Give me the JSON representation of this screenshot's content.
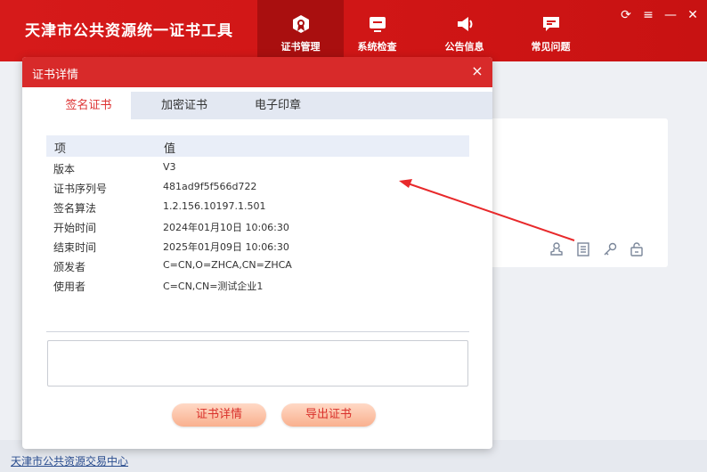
{
  "app": {
    "title": "天津市公共资源统一证书工具"
  },
  "nav": [
    {
      "label": "证书管理",
      "icon": "certificate-icon",
      "active": true
    },
    {
      "label": "系统检查",
      "icon": "monitor-icon",
      "active": false
    },
    {
      "label": "公告信息",
      "icon": "megaphone-icon",
      "active": false
    },
    {
      "label": "常见问题",
      "icon": "chat-icon",
      "active": false
    }
  ],
  "window_controls": {
    "refresh": "⟳",
    "menu": "≡",
    "minimize": "—",
    "close": "✕"
  },
  "dialog": {
    "title": "证书详情",
    "close": "×",
    "tabs": [
      {
        "label": "签名证书",
        "active": true
      },
      {
        "label": "加密证书",
        "active": false
      },
      {
        "label": "电子印章",
        "active": false
      }
    ],
    "table": {
      "headers": [
        "项",
        "值"
      ],
      "rows": [
        {
          "key": "版本",
          "value": "V3"
        },
        {
          "key": "证书序列号",
          "value": "481ad9f5f566d722"
        },
        {
          "key": "签名算法",
          "value": "1.2.156.10197.1.501"
        },
        {
          "key": "开始时间",
          "value": "2024年01月10日 10:06:30"
        },
        {
          "key": "结束时间",
          "value": "2025年01月09日 10:06:30"
        },
        {
          "key": "颁发者",
          "value": "C=CN,O=ZHCA,CN=ZHCA"
        },
        {
          "key": "使用者",
          "value": "C=CN,CN=测试企业1"
        }
      ]
    },
    "buttons": {
      "details": "证书详情",
      "export": "导出证书"
    }
  },
  "footer": {
    "link": "天津市公共资源交易中心"
  },
  "colors": {
    "brand_red": "#d61a1a",
    "accent": "#d33",
    "button_gradient_top": "#ffd9c6",
    "button_gradient_bottom": "#f9b08e"
  }
}
